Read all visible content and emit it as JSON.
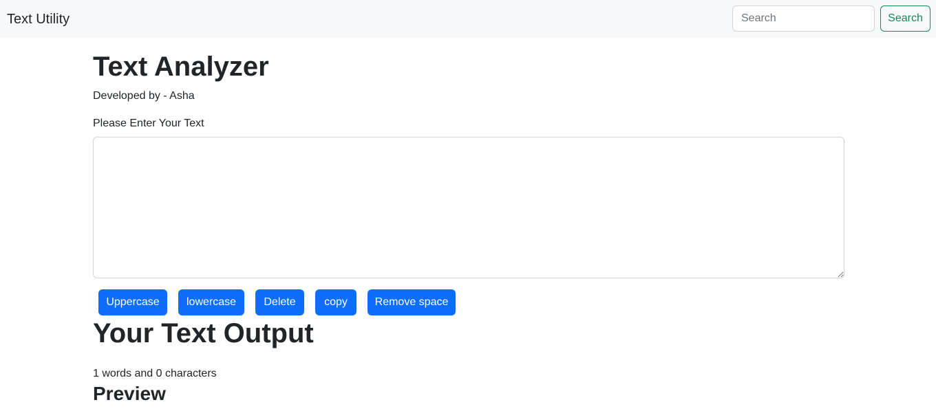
{
  "navbar": {
    "brand": "Text Utility",
    "search_placeholder": "Search",
    "search_button": "Search",
    "accent_color": "#198754",
    "background_color": "#f8f9fa"
  },
  "main": {
    "title": "Text Analyzer",
    "developer": "Developed by - Asha",
    "input_label": "Please Enter Your Text",
    "textarea_value": "",
    "buttons": [
      {
        "label": "Uppercase"
      },
      {
        "label": "lowercase"
      },
      {
        "label": "Delete"
      },
      {
        "label": "copy"
      },
      {
        "label": "Remove space"
      }
    ],
    "button_color": "#0d6efd",
    "output_title": "Your Text Output",
    "stats": "1 words and 0 characters",
    "preview_title": "Preview"
  }
}
